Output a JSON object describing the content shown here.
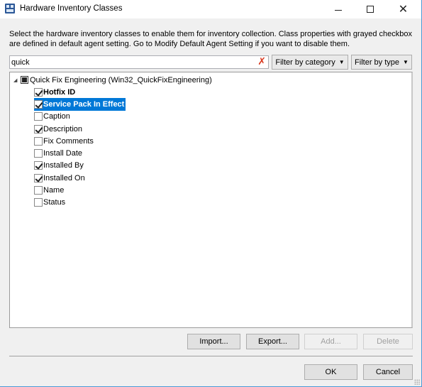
{
  "window": {
    "title": "Hardware Inventory Classes",
    "app_icon": "hardware-inventory-icon",
    "controls": {
      "minimize": "minimize-icon",
      "maximize": "maximize-icon",
      "close": "close-icon"
    }
  },
  "description": "Select the hardware inventory classes to enable them for inventory collection. Class properties with grayed checkbox are defined in default agent setting. Go to Modify Default Agent Setting if you want to disable them.",
  "search": {
    "value": "quick",
    "placeholder": "",
    "clear_icon": "clear-search-icon"
  },
  "filters": {
    "category_label": "Filter by category",
    "type_label": "Filter by type"
  },
  "tree": {
    "root": {
      "label": "Quick Fix Engineering (Win32_QuickFixEngineering)",
      "expanded": true,
      "check_state": "indeterminate"
    },
    "items": [
      {
        "label": "Hotfix ID",
        "checked": true,
        "bold": true,
        "selected": false
      },
      {
        "label": "Service Pack In Effect",
        "checked": true,
        "bold": true,
        "selected": true
      },
      {
        "label": "Caption",
        "checked": false,
        "bold": false,
        "selected": false
      },
      {
        "label": "Description",
        "checked": true,
        "bold": false,
        "selected": false
      },
      {
        "label": "Fix Comments",
        "checked": false,
        "bold": false,
        "selected": false
      },
      {
        "label": "Install Date",
        "checked": false,
        "bold": false,
        "selected": false
      },
      {
        "label": "Installed By",
        "checked": true,
        "bold": false,
        "selected": false
      },
      {
        "label": "Installed On",
        "checked": true,
        "bold": false,
        "selected": false
      },
      {
        "label": "Name",
        "checked": false,
        "bold": false,
        "selected": false
      },
      {
        "label": "Status",
        "checked": false,
        "bold": false,
        "selected": false
      }
    ]
  },
  "buttons": {
    "import": "Import...",
    "export": "Export...",
    "add": "Add...",
    "delete": "Delete",
    "ok": "OK",
    "cancel": "Cancel"
  },
  "colors": {
    "selection": "#0078d7",
    "clear_icon": "#d9381e",
    "window_border": "#4a9ad6"
  }
}
